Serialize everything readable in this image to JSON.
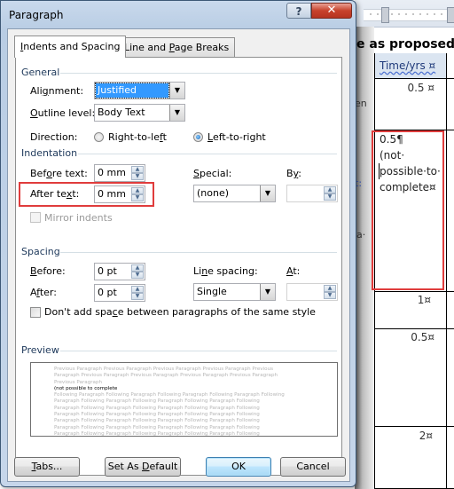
{
  "document": {
    "heading_fragment": "e as proposed ¶",
    "table": {
      "column_header": "Time/yrs ¤",
      "rows": [
        {
          "value": "0.5 ¤"
        },
        {
          "value_lines": [
            "0.5¶",
            "(not·",
            "possible·to·",
            "complete¤"
          ]
        },
        {
          "value": "1¤"
        },
        {
          "value": "0.5¤"
        },
        {
          "value": "2¤"
        }
      ],
      "side_fragments": [
        "en",
        "t:",
        "a·"
      ]
    }
  },
  "dialog": {
    "title": "Paragraph",
    "help_glyph": "?",
    "close_glyph": "✕",
    "tabs": [
      {
        "label_pre": "",
        "label_u": "I",
        "label_post": "ndents and Spacing",
        "active": true
      },
      {
        "label_pre": "Line and ",
        "label_u": "P",
        "label_post": "age Breaks",
        "active": false
      }
    ],
    "general": {
      "section": "General",
      "alignment": {
        "label_pre": "Ali",
        "label_u": "g",
        "label_post": "nment:",
        "value": "Justified"
      },
      "outline_level": {
        "label_pre": "",
        "label_u": "O",
        "label_post": "utline level:",
        "value": "Body Text"
      },
      "direction": {
        "label": "Direction:",
        "options": [
          {
            "label_pre": "Right-to-le",
            "label_u": "f",
            "label_post": "t",
            "checked": false
          },
          {
            "label_pre": "",
            "label_u": "L",
            "label_post": "eft-to-right",
            "checked": true
          }
        ]
      }
    },
    "indentation": {
      "section": "Indentation",
      "before_text": {
        "label_pre": "Bef",
        "label_u": "o",
        "label_post": "re text:",
        "value": "0 mm"
      },
      "after_text": {
        "label_pre": "After te",
        "label_u": "x",
        "label_post": "t:",
        "value": "0 mm"
      },
      "special": {
        "label_pre": "",
        "label_u": "S",
        "label_post": "pecial:",
        "value": "(none)"
      },
      "by": {
        "label_pre": "B",
        "label_u": "y",
        "label_post": ":",
        "value": ""
      },
      "mirror_indents": {
        "label": "Mirror indents",
        "checked": false,
        "disabled": true
      }
    },
    "spacing": {
      "section": "Spacing",
      "before": {
        "label_pre": "",
        "label_u": "B",
        "label_post": "efore:",
        "value": "0 pt"
      },
      "after": {
        "label_pre": "A",
        "label_u": "f",
        "label_post": "ter:",
        "value": "0 pt"
      },
      "line_spacing": {
        "label_pre": "Li",
        "label_u": "n",
        "label_post": "e spacing:",
        "value": "Single"
      },
      "at": {
        "label_pre": "",
        "label_u": "A",
        "label_post": "t:",
        "value": ""
      },
      "dont_add_space": {
        "label_pre": "Don't add spa",
        "label_u": "c",
        "label_post": "e between paragraphs of the same style",
        "checked": false
      }
    },
    "preview": {
      "section": "Preview",
      "previous_lines": [
        "Previous Paragraph Previous Paragraph Previous Paragraph Previous Paragraph Previous",
        "Paragraph Previous Paragraph Previous Paragraph Previous Paragraph Previous Paragraph",
        "Previous Paragraph"
      ],
      "current_line": "(not possible to complete",
      "following_lines": [
        "Following Paragraph Following Paragraph Following Paragraph Following Paragraph Following",
        "Paragraph Following Paragraph Following Paragraph Following Paragraph Following",
        "Paragraph Following Paragraph Following Paragraph Following Paragraph Following",
        "Paragraph Following Paragraph Following Paragraph Following Paragraph Following",
        "Paragraph Following Paragraph Following Paragraph Following Paragraph Following",
        "Paragraph Following Paragraph Following Paragraph Following Paragraph Following",
        "Paragraph Following Paragraph Following Paragraph Following Paragraph Following"
      ]
    },
    "buttons": {
      "tabs": {
        "label_pre": "",
        "label_u": "T",
        "label_post": "abs..."
      },
      "set_default": {
        "label_pre": "Set As ",
        "label_u": "D",
        "label_post": "efault"
      },
      "ok": "OK",
      "cancel": "Cancel"
    },
    "accent_colors": {
      "highlight_box": "#e03c3c",
      "selection": "#3399ff"
    }
  }
}
